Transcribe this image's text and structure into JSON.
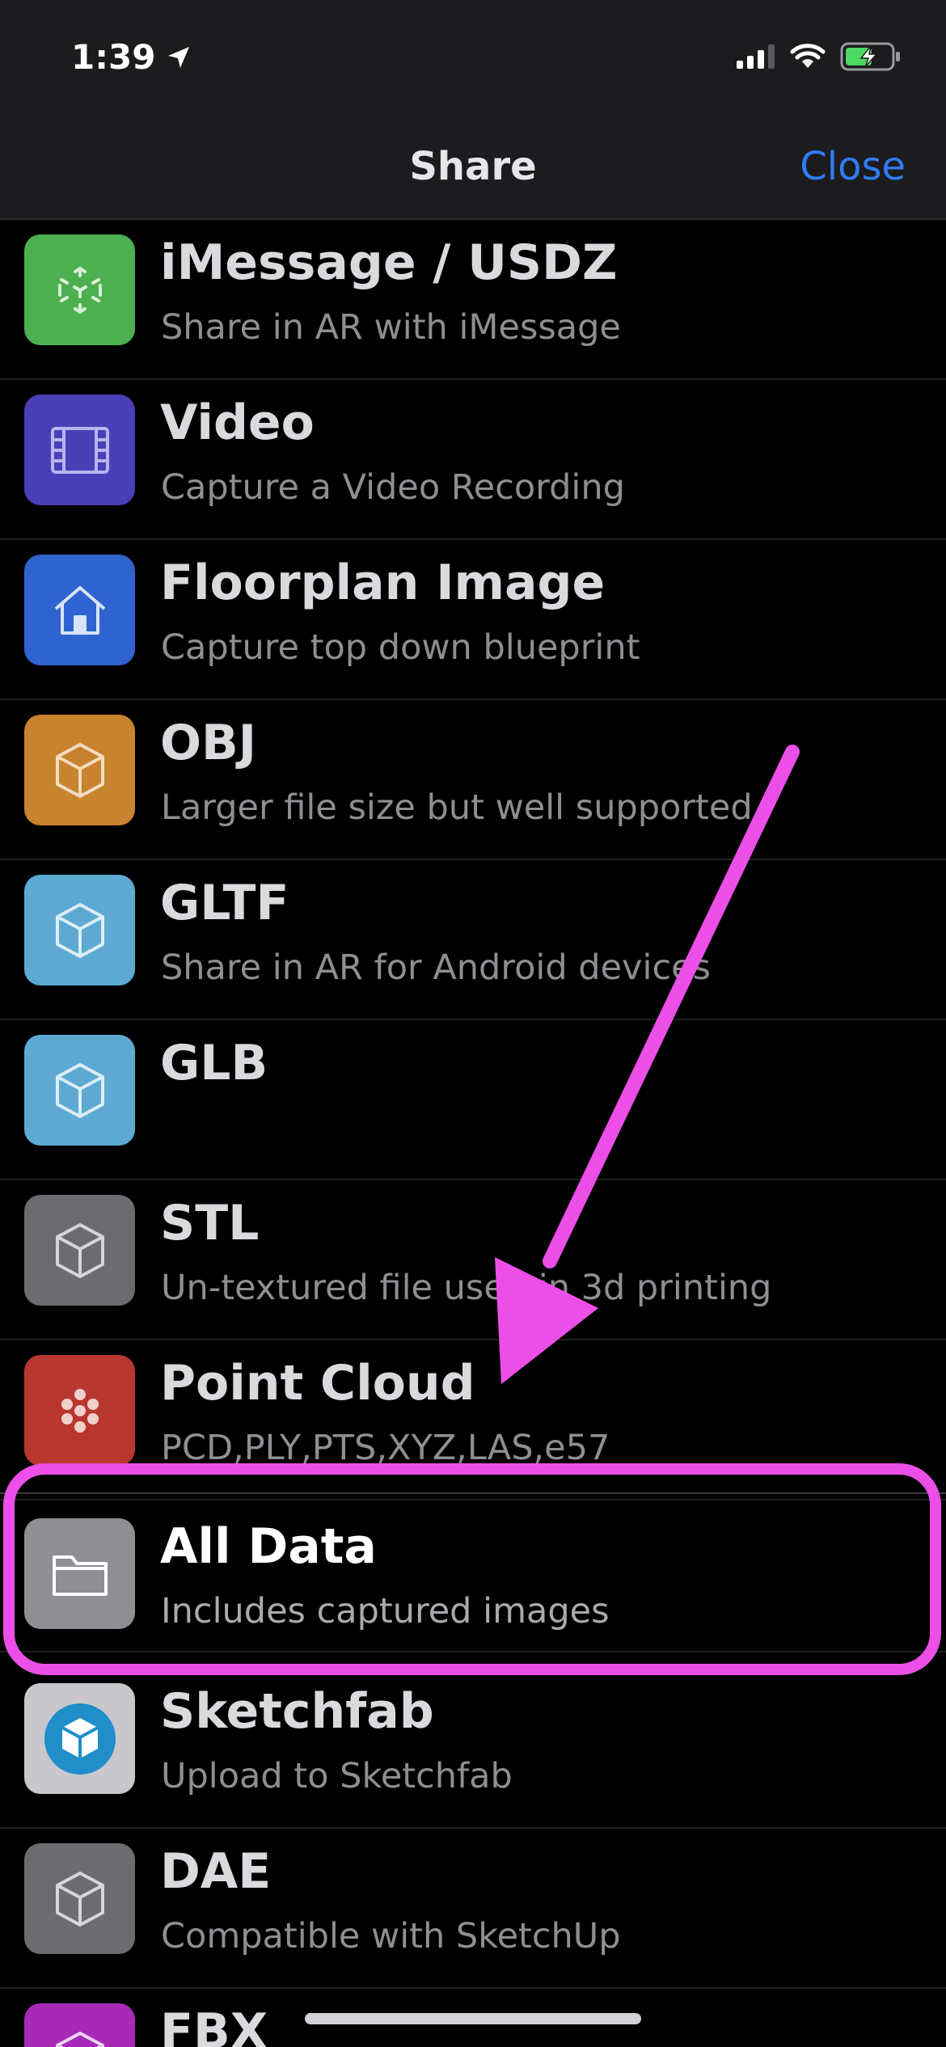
{
  "status_bar": {
    "time": "1:39"
  },
  "nav": {
    "title": "Share",
    "close_label": "Close"
  },
  "items": [
    {
      "title": "iMessage  /  USDZ",
      "subtitle": "Share in AR with iMessage",
      "icon": "ar-cube-icon",
      "color": "#4caf50"
    },
    {
      "title": "Video",
      "subtitle": "Capture a Video Recording",
      "icon": "film-icon",
      "color": "#4b3fb8"
    },
    {
      "title": "Floorplan Image",
      "subtitle": "Capture top down blueprint",
      "icon": "house-icon",
      "color": "#2f63cf"
    },
    {
      "title": "OBJ",
      "subtitle": "Larger file size but well supported",
      "icon": "cube-icon",
      "color": "#c7832e"
    },
    {
      "title": "GLTF",
      "subtitle": "Share in AR for Android devices",
      "icon": "cube-icon",
      "color": "#5ea9d1"
    },
    {
      "title": "GLB",
      "subtitle": "",
      "icon": "cube-icon",
      "color": "#5ea9d1"
    },
    {
      "title": "STL",
      "subtitle": "Un-textured file used in 3d printing",
      "icon": "cube-icon",
      "color": "#6b6b70"
    },
    {
      "title": "Point Cloud",
      "subtitle": "PCD,PLY,PTS,XYZ,LAS,e57",
      "icon": "point-cloud-icon",
      "color": "#b8372f"
    },
    {
      "title": "All Data",
      "subtitle": "Includes captured images",
      "icon": "folder-icon",
      "color": "#8e8e93"
    },
    {
      "title": "Sketchfab",
      "subtitle": "Upload to Sketchfab",
      "icon": "sketchfab-icon",
      "color": "#c7c7cc"
    },
    {
      "title": "DAE",
      "subtitle": "Compatible with SketchUp",
      "icon": "cube-icon",
      "color": "#6b6b70"
    },
    {
      "title": "FBX",
      "subtitle": "",
      "icon": "cube-icon",
      "color": "#a829b5"
    }
  ],
  "annotation": {
    "color": "#ec4fe7"
  }
}
